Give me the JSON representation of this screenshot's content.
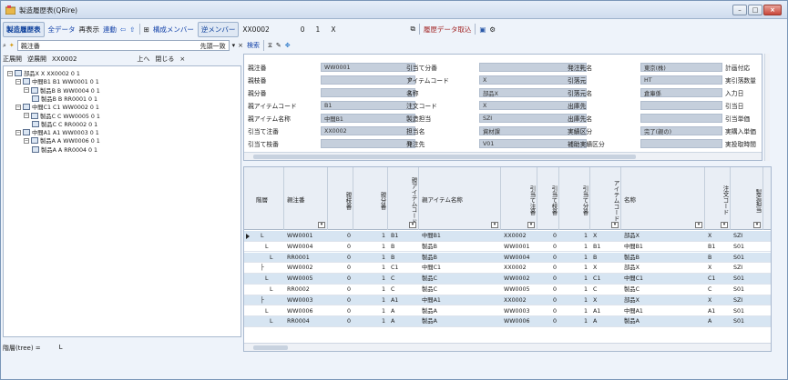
{
  "window": {
    "title": "製造履歴表(QRire)",
    "title_icon": "app-icon"
  },
  "toolbar1": {
    "main_tab": "製造履歴表",
    "all_data": "全データ",
    "redisplay": "再表示",
    "link": "連動",
    "components": "構成メンバー",
    "reverse_components": "逆メンバー",
    "code_field": "XX0002",
    "num1": "0",
    "num2": "1",
    "x_field": "X",
    "history_import": "履歴データ取込"
  },
  "toolbar2": {
    "search_label": "親注番",
    "search_mode": "先頭一致",
    "search_button": "検索"
  },
  "tree_header": {
    "expand_all": "正展開",
    "reverse_expand": "逆展開",
    "code": "XX0002",
    "up": "上へ",
    "close": "閉じる"
  },
  "tree": [
    {
      "label": "部品X X XX0002 0 1",
      "level": 0,
      "toggle": "−"
    },
    {
      "label": "中間B1 B1 WW0001 0 1",
      "level": 1,
      "toggle": "−"
    },
    {
      "label": "製品B B WW0004 0 1",
      "level": 2,
      "toggle": "−"
    },
    {
      "label": "製品B B RR0001 0 1",
      "level": 3,
      "toggle": ""
    },
    {
      "label": "中間C1 C1 WW0002 0 1",
      "level": 1,
      "toggle": "−"
    },
    {
      "label": "製品C C WW0005 0 1",
      "level": 2,
      "toggle": "−"
    },
    {
      "label": "製品C C RR0002 0 1",
      "level": 3,
      "toggle": ""
    },
    {
      "label": "中間A1 A1 WW0003 0 1",
      "level": 1,
      "toggle": "−"
    },
    {
      "label": "製品A A WW0006 0 1",
      "level": 2,
      "toggle": "−"
    },
    {
      "label": "製品A A RR0004 0 1",
      "level": 3,
      "toggle": ""
    }
  ],
  "status": {
    "label": "階層(tree) =",
    "value": "L"
  },
  "detail": {
    "col1": [
      {
        "label": "親注番",
        "value": "WW0001",
        "align": "left"
      },
      {
        "label": "親枝番",
        "value": "0",
        "align": "right"
      },
      {
        "label": "親分番",
        "value": "1",
        "align": "right"
      },
      {
        "label": "親アイテムコード",
        "value": "B1",
        "align": "left"
      },
      {
        "label": "親アイテム名称",
        "value": "中間B1",
        "align": "left"
      },
      {
        "label": "引当て注番",
        "value": "XX0002",
        "align": "left"
      },
      {
        "label": "引当て枝番",
        "value": "0",
        "align": "right"
      }
    ],
    "col2": [
      {
        "label": "引当て分番",
        "value": "1",
        "align": "right"
      },
      {
        "label": "アイテムコード",
        "value": "X",
        "align": "left"
      },
      {
        "label": "名称",
        "value": "部品X",
        "align": "left"
      },
      {
        "label": "注文コード",
        "value": "X",
        "align": "left"
      },
      {
        "label": "製造担当",
        "value": "SZI",
        "align": "left"
      },
      {
        "label": "担当名",
        "value": "資材課",
        "align": "left"
      },
      {
        "label": "発注先",
        "value": "V01",
        "align": "left"
      }
    ],
    "col3": [
      {
        "label": "発注先名",
        "value": "東京(株)",
        "align": "left"
      },
      {
        "label": "引落元",
        "value": "HT",
        "align": "left"
      },
      {
        "label": "引落元名",
        "value": "倉庫係",
        "align": "left"
      },
      {
        "label": "出庫先",
        "value": "",
        "align": "left"
      },
      {
        "label": "出庫先名",
        "value": "",
        "align": "left"
      },
      {
        "label": "実績区分",
        "value": "完了(親の)",
        "align": "left"
      },
      {
        "label": "補助実績区分",
        "value": "",
        "align": "left"
      }
    ],
    "col4": [
      "計画付応",
      "実引落数量",
      "入力日",
      "引当日",
      "引当単価",
      "実購入単価",
      "実投取時間"
    ]
  },
  "grid": {
    "headers": [
      {
        "label": "階層",
        "vert": false,
        "filter": false
      },
      {
        "label": "親注番",
        "vert": false,
        "filter": true
      },
      {
        "label": "親枝番",
        "vert": true,
        "filter": false
      },
      {
        "label": "親分番",
        "vert": true,
        "filter": false
      },
      {
        "label": "親アイテムコード",
        "vert": true,
        "filter": true
      },
      {
        "label": "親アイテム名称",
        "vert": false,
        "filter": true
      },
      {
        "label": "引当て注番",
        "vert": true,
        "filter": true
      },
      {
        "label": "引当て枝番",
        "vert": true,
        "filter": false
      },
      {
        "label": "引当て分番",
        "vert": true,
        "filter": false
      },
      {
        "label": "アイテムコード",
        "vert": true,
        "filter": true
      },
      {
        "label": "名称",
        "vert": false,
        "filter": true
      },
      {
        "label": "注文コード",
        "vert": true,
        "filter": true
      },
      {
        "label": "製造担当",
        "vert": true,
        "filter": true
      }
    ],
    "rows": [
      [
        "L",
        "WW0001",
        "0",
        "1",
        "B1",
        "中間B1",
        "XX0002",
        "0",
        "1",
        "X",
        "部品X",
        "X",
        "SZI"
      ],
      [
        "L",
        "WW0004",
        "0",
        "1",
        "B",
        "製品B",
        "WW0001",
        "0",
        "1",
        "B1",
        "中間B1",
        "B1",
        "S01"
      ],
      [
        "L",
        "RR0001",
        "0",
        "1",
        "B",
        "製品B",
        "WW0004",
        "0",
        "1",
        "B",
        "製品B",
        "B",
        "S01"
      ],
      [
        "├",
        "WW0002",
        "0",
        "1",
        "C1",
        "中間C1",
        "XX0002",
        "0",
        "1",
        "X",
        "部品X",
        "X",
        "SZI"
      ],
      [
        "L",
        "WW0005",
        "0",
        "1",
        "C",
        "製品C",
        "WW0002",
        "0",
        "1",
        "C1",
        "中間C1",
        "C1",
        "S01"
      ],
      [
        "L",
        "RR0002",
        "0",
        "1",
        "C",
        "製品C",
        "WW0005",
        "0",
        "1",
        "C",
        "製品C",
        "C",
        "S01"
      ],
      [
        "├",
        "WW0003",
        "0",
        "1",
        "A1",
        "中間A1",
        "XX0002",
        "0",
        "1",
        "X",
        "部品X",
        "X",
        "SZI"
      ],
      [
        "L",
        "WW0006",
        "0",
        "1",
        "A",
        "製品A",
        "WW0003",
        "0",
        "1",
        "A1",
        "中間A1",
        "A1",
        "S01"
      ],
      [
        "L",
        "RR0004",
        "0",
        "1",
        "A",
        "製品A",
        "WW0006",
        "0",
        "1",
        "A",
        "製品A",
        "A",
        "S01"
      ]
    ],
    "indents": [
      1,
      2,
      3,
      1,
      2,
      3,
      1,
      2,
      3
    ]
  },
  "colors": {
    "accent": "#0c3f9b",
    "row_alt": "#d7e5f2",
    "field": "#c5cfdc"
  }
}
